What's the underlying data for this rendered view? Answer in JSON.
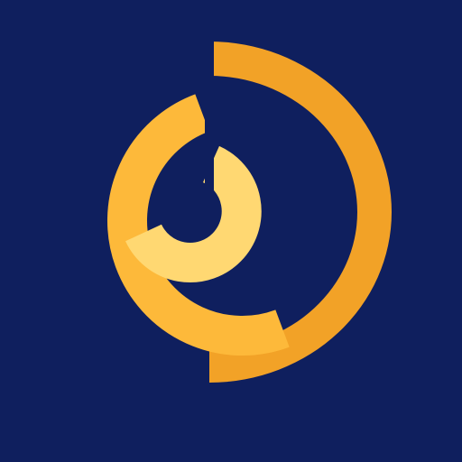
{
  "app": {
    "kind": "app-icon"
  },
  "colors": {
    "background": "#0F1F5E",
    "outer_arc": "#F2A227",
    "middle_arc": "#FDB93A",
    "inner_arc": "#FFD872"
  },
  "icons": {
    "logo": "concentric-arcs-logo-icon"
  }
}
